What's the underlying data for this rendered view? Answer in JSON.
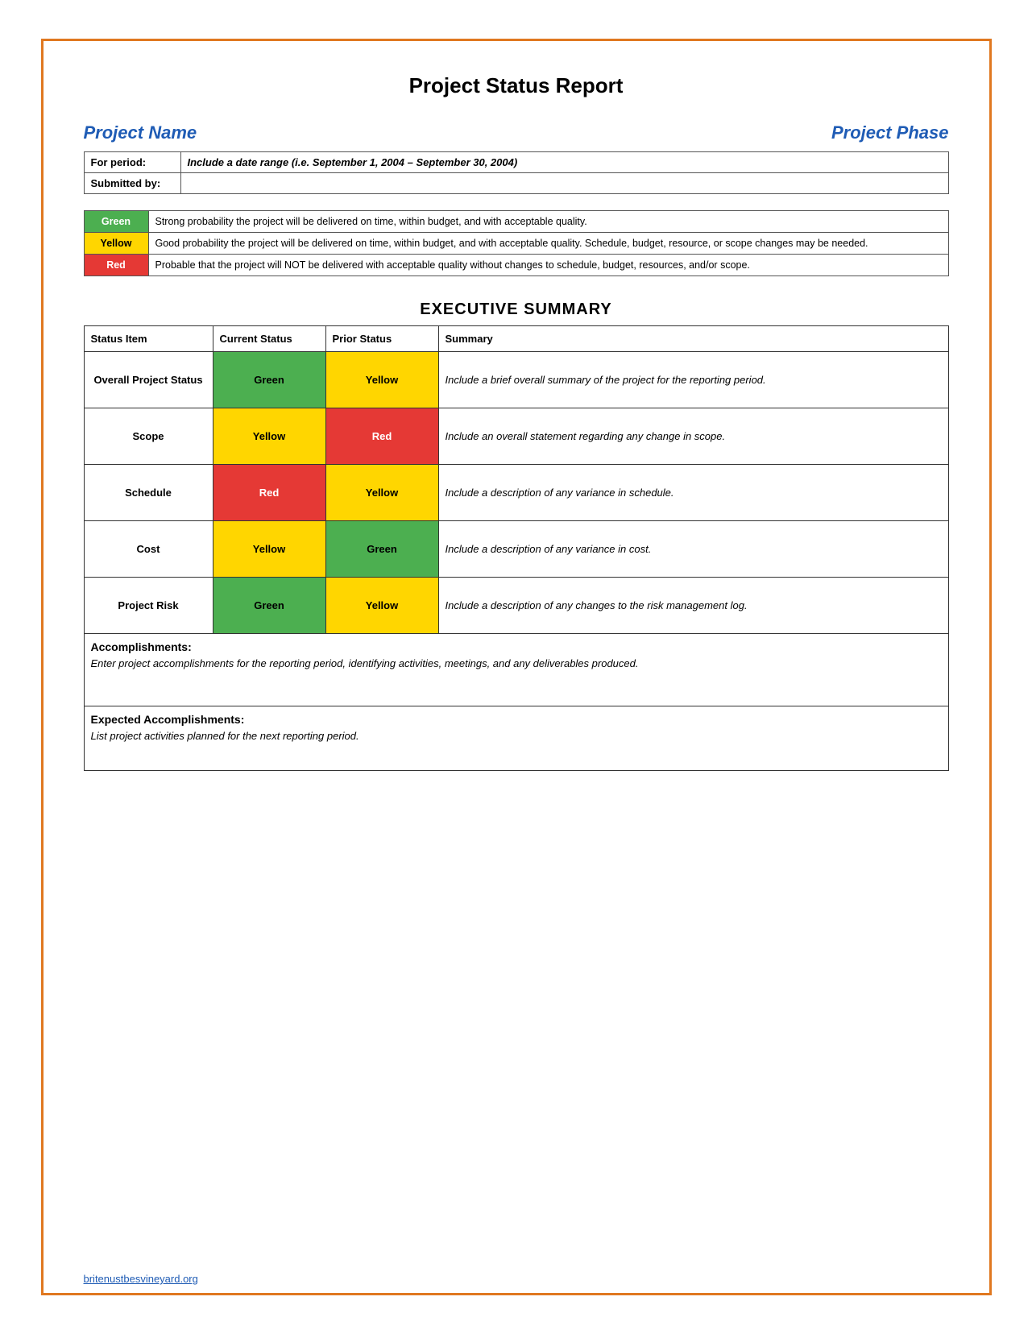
{
  "page": {
    "title": "Project Status Report",
    "border_color": "#e07820"
  },
  "header": {
    "project_name_label": "Project Name",
    "project_phase_label": "Project Phase"
  },
  "info_rows": [
    {
      "label": "For period:",
      "value": "Include a date range (i.e. September 1, 2004 – September 30, 2004)"
    },
    {
      "label": "Submitted by:",
      "value": ""
    }
  ],
  "legend": [
    {
      "color_label": "Green",
      "color_class": "legend-green",
      "description": "Strong probability the project will be delivered on time, within budget, and with acceptable quality."
    },
    {
      "color_label": "Yellow",
      "color_class": "legend-yellow",
      "description": "Good probability the project will be delivered on time, within budget, and with acceptable quality. Schedule, budget, resource, or scope changes may be needed."
    },
    {
      "color_label": "Red",
      "color_class": "legend-red",
      "description": "Probable that the project will NOT be delivered with acceptable quality without changes to schedule, budget, resources, and/or scope."
    }
  ],
  "executive_summary": {
    "title": "EXECUTIVE SUMMARY",
    "columns": [
      "Status Item",
      "Current Status",
      "Prior Status",
      "Summary"
    ],
    "rows": [
      {
        "item": "Overall Project Status",
        "current_status": "Green",
        "current_class": "status-green",
        "prior_status": "Yellow",
        "prior_class": "status-yellow",
        "summary": "Include a brief overall summary of the project for the reporting period."
      },
      {
        "item": "Scope",
        "current_status": "Yellow",
        "current_class": "status-yellow",
        "prior_status": "Red",
        "prior_class": "status-red",
        "summary": "Include an overall statement regarding any change in scope."
      },
      {
        "item": "Schedule",
        "current_status": "Red",
        "current_class": "status-red",
        "prior_status": "Yellow",
        "prior_class": "status-yellow",
        "summary": "Include a description of any variance in schedule."
      },
      {
        "item": "Cost",
        "current_status": "Yellow",
        "current_class": "status-yellow",
        "prior_status": "Green",
        "prior_class": "status-green",
        "summary": "Include a description of any variance in cost."
      },
      {
        "item": "Project Risk",
        "current_status": "Green",
        "current_class": "status-green",
        "prior_status": "Yellow",
        "prior_class": "status-yellow",
        "summary": "Include a description of any changes to the risk management log."
      }
    ]
  },
  "accomplishments": {
    "title": "Accomplishments:",
    "text": "Enter project accomplishments for the reporting period, identifying activities, meetings, and any deliverables produced."
  },
  "expected_accomplishments": {
    "title": "Expected Accomplishments:",
    "text": "List project activities planned for the next reporting period."
  },
  "footer": {
    "text": "britenustbesvineyard.org"
  }
}
